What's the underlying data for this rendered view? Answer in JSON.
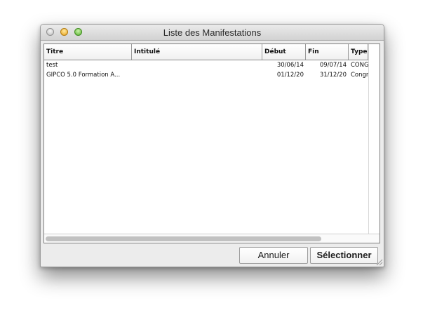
{
  "window": {
    "title": "Liste des Manifestations"
  },
  "table": {
    "columns": [
      "Titre",
      "Intitulé",
      "Début",
      "Fin",
      "Type"
    ],
    "rows": [
      {
        "titre": "test",
        "intitule": "",
        "debut": "30/06/14",
        "fin": "09/07/14",
        "type": "CONGR"
      },
      {
        "titre": "GIPCO 5.0 Formation A...",
        "intitule": "",
        "debut": "01/12/20",
        "fin": "31/12/20",
        "type": "Congr"
      }
    ]
  },
  "buttons": {
    "cancel_label": "Annuler",
    "select_label": "Sélectionner"
  },
  "icons": [
    "close-icon",
    "minimize-icon",
    "zoom-icon",
    "resize-grip-icon"
  ]
}
